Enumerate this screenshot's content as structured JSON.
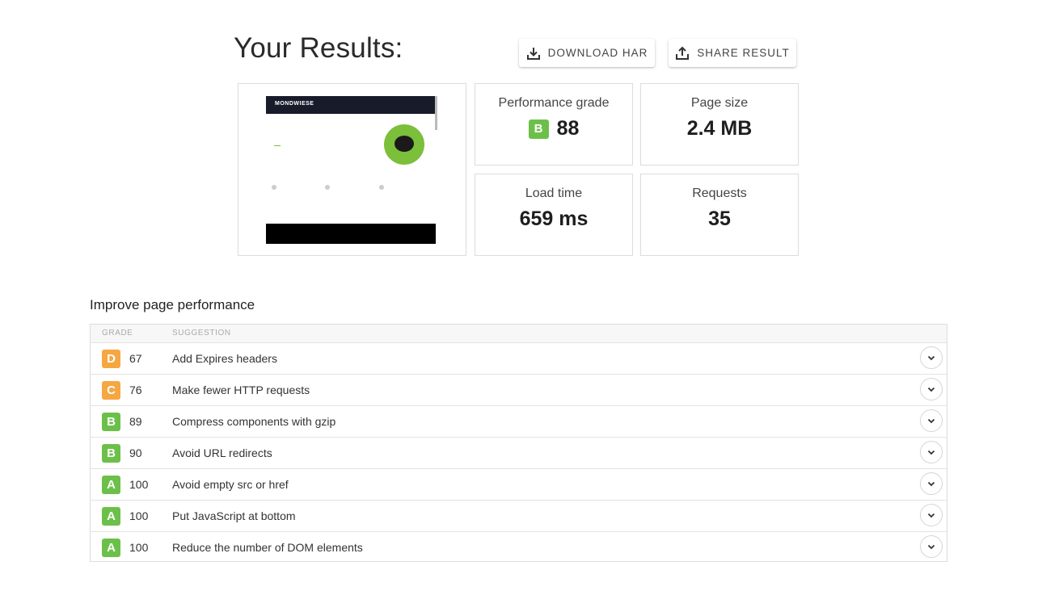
{
  "header": {
    "title": "Your Results:",
    "download_label": "DOWNLOAD HAR",
    "share_label": "SHARE RESULT"
  },
  "thumbnail": {
    "site_logo": "MONDWIESE"
  },
  "metrics": {
    "grade": {
      "label": "Performance grade",
      "letter": "B",
      "value": "88"
    },
    "page_size": {
      "label": "Page size",
      "value": "2.4 MB"
    },
    "load_time": {
      "label": "Load time",
      "value": "659 ms"
    },
    "requests": {
      "label": "Requests",
      "value": "35"
    }
  },
  "improve": {
    "title": "Improve page performance",
    "columns": {
      "grade": "GRADE",
      "suggestion": "SUGGESTION"
    },
    "rows": [
      {
        "grade": "D",
        "score": "67",
        "suggestion": "Add Expires headers"
      },
      {
        "grade": "C",
        "score": "76",
        "suggestion": "Make fewer HTTP requests"
      },
      {
        "grade": "B",
        "score": "89",
        "suggestion": "Compress components with gzip"
      },
      {
        "grade": "B",
        "score": "90",
        "suggestion": "Avoid URL redirects"
      },
      {
        "grade": "A",
        "score": "100",
        "suggestion": "Avoid empty src or href"
      },
      {
        "grade": "A",
        "score": "100",
        "suggestion": "Put JavaScript at bottom"
      },
      {
        "grade": "A",
        "score": "100",
        "suggestion": "Reduce the number of DOM elements"
      }
    ]
  },
  "icons": {
    "download": "download-icon",
    "share": "share-icon",
    "expand": "chevron-down-icon"
  },
  "colors": {
    "grade_a": "#6cc04a",
    "grade_b": "#6cc04a",
    "grade_c": "#f5a742",
    "grade_d": "#f5a742"
  }
}
